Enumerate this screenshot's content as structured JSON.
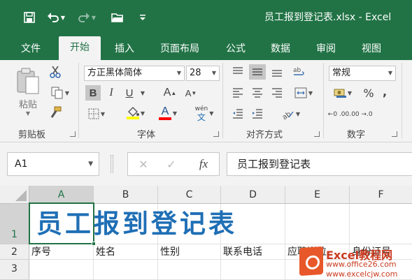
{
  "window": {
    "title": "员工报到登记表.xlsx  -  Excel",
    "brand_color": "#217346"
  },
  "quick_access": {
    "icons": [
      "save-icon",
      "undo-icon",
      "redo-icon",
      "open-icon",
      "customize-icon"
    ]
  },
  "tabs": [
    {
      "label": "文件",
      "active": false
    },
    {
      "label": "开始",
      "active": true
    },
    {
      "label": "插入",
      "active": false
    },
    {
      "label": "页面布局",
      "active": false
    },
    {
      "label": "公式",
      "active": false
    },
    {
      "label": "数据",
      "active": false
    },
    {
      "label": "审阅",
      "active": false
    },
    {
      "label": "视图",
      "active": false
    }
  ],
  "ribbon": {
    "clipboard": {
      "label": "剪贴板",
      "paste_label": "粘贴"
    },
    "font": {
      "label": "字体",
      "font_name": "方正黑体简体",
      "font_size": "28",
      "bold": "B",
      "italic": "I",
      "underline": "U",
      "grow": "A",
      "shrink": "A",
      "font_color_glyph": "A",
      "phonetic": "wén",
      "phonetic_char": "文",
      "highlight_color": "#ffff00",
      "font_color": "#ff0000"
    },
    "alignment": {
      "label": "对齐方式"
    },
    "number": {
      "label": "数字",
      "format": "常规",
      "percent": "%",
      "comma": ",",
      "inc_decimal": "←0 .00",
      "dec_decimal": ".00 →.0"
    }
  },
  "formula_bar": {
    "name_box": "A1",
    "fx": "fx",
    "content": "员工报到登记表"
  },
  "grid": {
    "columns": [
      "A",
      "B",
      "C",
      "D",
      "E",
      "F"
    ],
    "rows": [
      "1",
      "2",
      "3"
    ],
    "title": "员工报到登记表",
    "title_color": "#1f6fb5",
    "headers": [
      "序号",
      "姓名",
      "性别",
      "联系电话",
      "应聘岗位",
      "身份证号"
    ]
  },
  "watermark": {
    "title": "Excel教程网",
    "url1": "www.office26.com",
    "url2": "www.excelcjw.com"
  }
}
